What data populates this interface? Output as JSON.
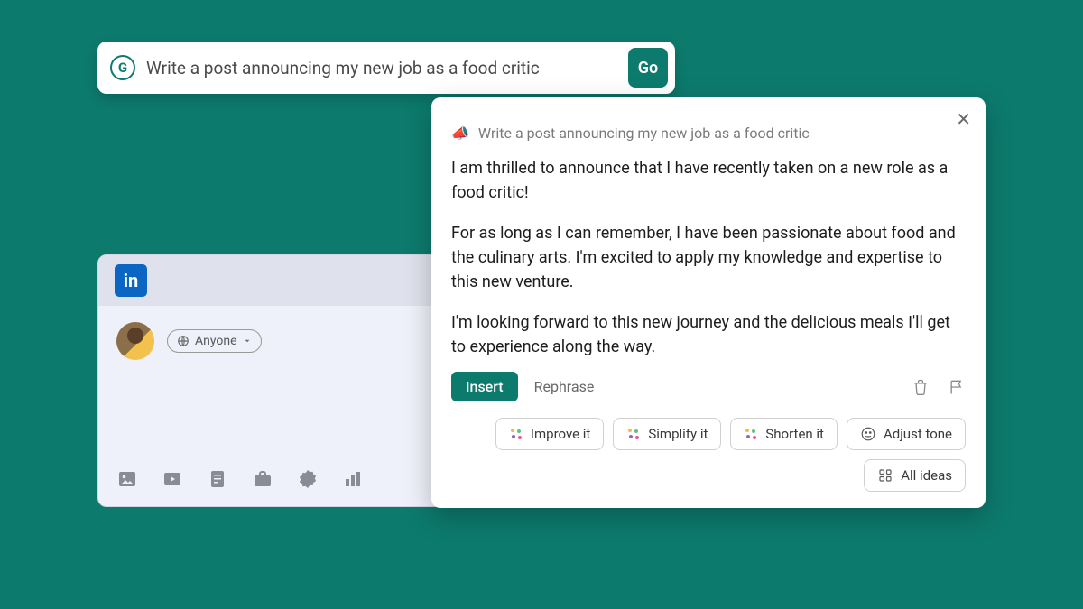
{
  "prompt": {
    "text": "Write a post announcing my new job as a food critic",
    "go_label": "Go"
  },
  "linkedin": {
    "logo_text": "in",
    "audience_label": "Anyone"
  },
  "panel": {
    "echo": "Write a post announcing my new job as a food critic",
    "paragraphs": [
      "I am thrilled to announce that I have recently taken on a new role as a food critic!",
      "For as long as I can remember, I have been passionate about food and the culinary arts. I'm excited to apply my knowledge and expertise to this new venture.",
      "I'm looking forward to this new journey and the delicious meals I'll get to experience along the way."
    ],
    "insert_label": "Insert",
    "rephrase_label": "Rephrase",
    "chips": {
      "improve": "Improve it",
      "simplify": "Simplify it",
      "shorten": "Shorten it",
      "adjust": "Adjust tone",
      "all": "All ideas"
    }
  }
}
